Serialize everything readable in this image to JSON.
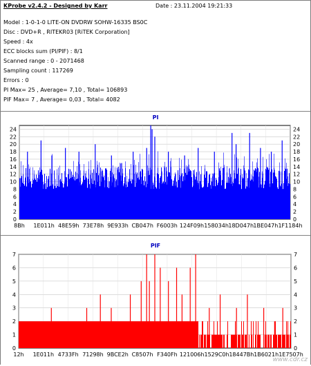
{
  "header": {
    "title": "KProbe v2.4.2 - Designed by Karr",
    "date": "Date : 23.11.2004 19:21:33",
    "lines": [
      "Model : 1-0-1-0 LITE-ON DVDRW SOHW-16335 BS0C",
      "Disc : DVD+R , RITEKR03 [RiTEK Corporation]",
      "Speed : 4x",
      "ECC blocks sum (PI/PIF) : 8/1",
      "Scanned range : 0 - 2071468",
      "Sampling count : 117269",
      "Errors : 0",
      "PI Max= 25 , Average= 7,10 , Total= 106893",
      "PIF Max= 7 , Average= 0,03 , Total= 4082"
    ]
  },
  "watermark": "www.cdr.cz",
  "colors": {
    "pi": "#0000ff",
    "pif": "#ff0000",
    "title_pi": "#0000c0",
    "title_pif": "#0000c0"
  },
  "chart_data": [
    {
      "type": "area",
      "title": "PI",
      "yticks": [
        0,
        2,
        4,
        6,
        8,
        10,
        12,
        14,
        16,
        18,
        20,
        22,
        24
      ],
      "ylim": [
        0,
        25
      ],
      "xticks": [
        "8Bh",
        "1E011h",
        "48E59h",
        "73E78h",
        "9E933h",
        "CB047h",
        "F6003h",
        "124F09h",
        "158034h",
        "18D047h",
        "1BE047h",
        "1F1184h"
      ],
      "baseline_low": 8,
      "baseline_high": 14,
      "spikes": [
        {
          "x": 0.03,
          "y": 18
        },
        {
          "x": 0.08,
          "y": 21
        },
        {
          "x": 0.12,
          "y": 17
        },
        {
          "x": 0.17,
          "y": 19
        },
        {
          "x": 0.22,
          "y": 18
        },
        {
          "x": 0.28,
          "y": 20
        },
        {
          "x": 0.34,
          "y": 17
        },
        {
          "x": 0.42,
          "y": 18
        },
        {
          "x": 0.47,
          "y": 19
        },
        {
          "x": 0.485,
          "y": 25
        },
        {
          "x": 0.49,
          "y": 24
        },
        {
          "x": 0.5,
          "y": 22
        },
        {
          "x": 0.55,
          "y": 18
        },
        {
          "x": 0.61,
          "y": 17
        },
        {
          "x": 0.66,
          "y": 19
        },
        {
          "x": 0.72,
          "y": 18
        },
        {
          "x": 0.785,
          "y": 23
        },
        {
          "x": 0.8,
          "y": 20
        },
        {
          "x": 0.85,
          "y": 23
        },
        {
          "x": 0.89,
          "y": 19
        },
        {
          "x": 0.93,
          "y": 18
        },
        {
          "x": 0.97,
          "y": 21
        }
      ]
    },
    {
      "type": "bar",
      "title": "PIF",
      "yticks": [
        0,
        1,
        2,
        3,
        4,
        5,
        6,
        7
      ],
      "ylim": [
        0,
        7
      ],
      "xticks": [
        "12h",
        "1E011h",
        "4733Fh",
        "71298h",
        "9BCE2h",
        "C8507h",
        "F340Fh",
        "121006h",
        "1529C0h",
        "18447Bh",
        "1B6021h",
        "1E7507h"
      ],
      "block": {
        "from": 0.0,
        "to": 0.66,
        "value": 2
      },
      "tail_value": 1,
      "spikes": [
        {
          "x": 0.12,
          "y": 3
        },
        {
          "x": 0.25,
          "y": 3
        },
        {
          "x": 0.3,
          "y": 4
        },
        {
          "x": 0.34,
          "y": 3
        },
        {
          "x": 0.41,
          "y": 4
        },
        {
          "x": 0.45,
          "y": 5
        },
        {
          "x": 0.47,
          "y": 7
        },
        {
          "x": 0.48,
          "y": 5
        },
        {
          "x": 0.5,
          "y": 7
        },
        {
          "x": 0.52,
          "y": 6
        },
        {
          "x": 0.55,
          "y": 5
        },
        {
          "x": 0.58,
          "y": 6
        },
        {
          "x": 0.6,
          "y": 4
        },
        {
          "x": 0.63,
          "y": 6
        },
        {
          "x": 0.65,
          "y": 7
        },
        {
          "x": 0.7,
          "y": 3
        },
        {
          "x": 0.74,
          "y": 4
        },
        {
          "x": 0.8,
          "y": 3
        },
        {
          "x": 0.84,
          "y": 4
        },
        {
          "x": 0.9,
          "y": 3
        },
        {
          "x": 0.94,
          "y": 2
        },
        {
          "x": 0.97,
          "y": 3
        }
      ]
    }
  ]
}
